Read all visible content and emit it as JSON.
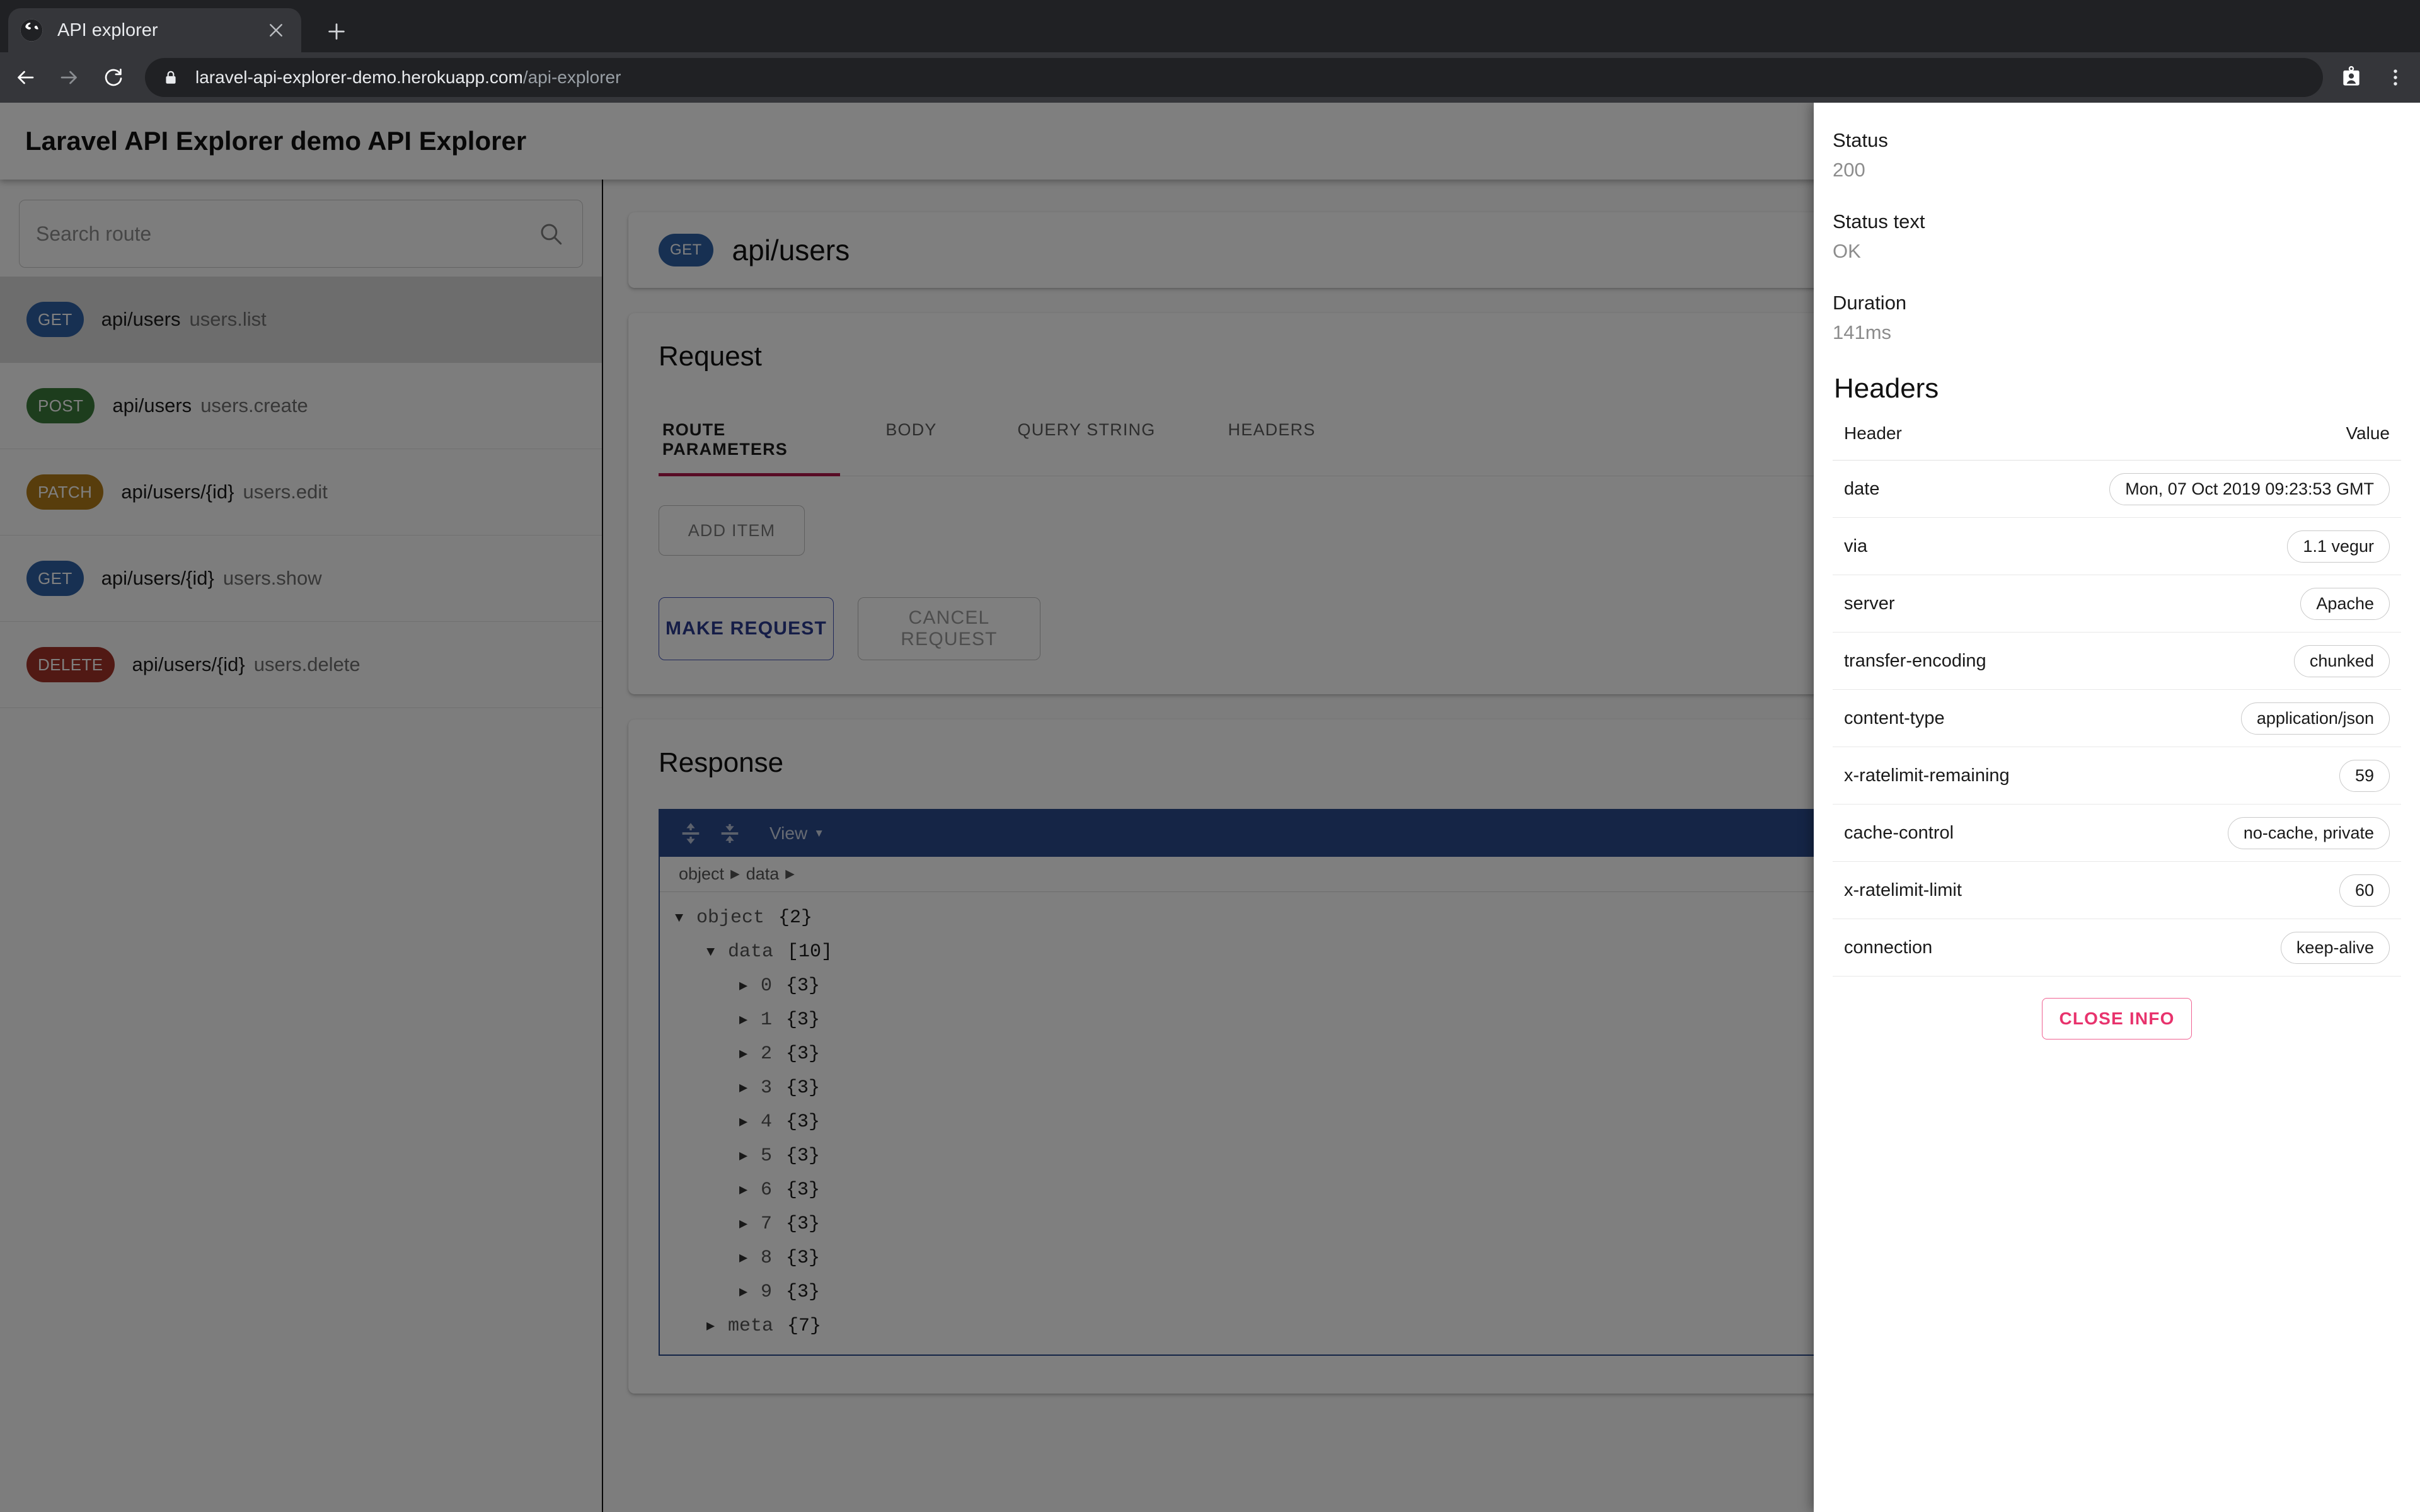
{
  "browser": {
    "tab": {
      "title": "API explorer",
      "favicon_icon": "globe-icon",
      "close_icon": "close-icon"
    },
    "new_tab_icon": "plus-icon",
    "back_icon": "arrow-left-icon",
    "forward_icon": "arrow-right-icon",
    "reload_icon": "reload-icon",
    "lock_icon": "lock-icon",
    "url_domain": "laravel-api-explorer-demo.herokuapp.com",
    "url_path": "/api-explorer",
    "profile_icon": "contact-card-icon",
    "menu_icon": "more-vertical-icon"
  },
  "appbar": {
    "title": "Laravel API Explorer demo API Explorer"
  },
  "sidebar": {
    "search": {
      "placeholder": "Search route",
      "value": "",
      "icon": "search-icon"
    },
    "routes": [
      {
        "method": "GET",
        "uri": "api/users",
        "name": "users.list",
        "color": "#2f61a5",
        "selected": true
      },
      {
        "method": "POST",
        "uri": "api/users",
        "name": "users.create",
        "color": "#3a7a3a",
        "selected": false
      },
      {
        "method": "PATCH",
        "uri": "api/users/{id}",
        "name": "users.edit",
        "color": "#b07a18",
        "selected": false
      },
      {
        "method": "GET",
        "uri": "api/users/{id}",
        "name": "users.show",
        "color": "#2f61a5",
        "selected": false
      },
      {
        "method": "DELETE",
        "uri": "api/users/{id}",
        "name": "users.delete",
        "color": "#a33228",
        "selected": false
      }
    ]
  },
  "main": {
    "route_header": {
      "method": "GET",
      "uri": "api/users",
      "color": "#2f61a5"
    },
    "request": {
      "title": "Request",
      "tabs": [
        {
          "label": "ROUTE PARAMETERS",
          "active": true
        },
        {
          "label": "BODY",
          "active": false
        },
        {
          "label": "QUERY STRING",
          "active": false
        },
        {
          "label": "HEADERS",
          "active": false
        }
      ],
      "add_item_label": "ADD ITEM",
      "make_request_label": "MAKE REQUEST",
      "cancel_request_label": "CANCEL REQUEST"
    },
    "response": {
      "title": "Response",
      "viewer": {
        "expand_all_icon": "expand-all-icon",
        "collapse_all_icon": "collapse-all-icon",
        "view_menu_label": "View",
        "view_menu_caret_icon": "caret-down-icon",
        "breadcrumb": [
          "object",
          "data"
        ],
        "accent_color": "#2b4b8c",
        "tree": [
          {
            "depth": 0,
            "twisty": "▼",
            "key": "object",
            "count": "{2}"
          },
          {
            "depth": 1,
            "twisty": "▼",
            "key": "data",
            "count": "[10]"
          },
          {
            "depth": 2,
            "twisty": "▶",
            "key": "0",
            "count": "{3}"
          },
          {
            "depth": 2,
            "twisty": "▶",
            "key": "1",
            "count": "{3}"
          },
          {
            "depth": 2,
            "twisty": "▶",
            "key": "2",
            "count": "{3}"
          },
          {
            "depth": 2,
            "twisty": "▶",
            "key": "3",
            "count": "{3}"
          },
          {
            "depth": 2,
            "twisty": "▶",
            "key": "4",
            "count": "{3}"
          },
          {
            "depth": 2,
            "twisty": "▶",
            "key": "5",
            "count": "{3}"
          },
          {
            "depth": 2,
            "twisty": "▶",
            "key": "6",
            "count": "{3}"
          },
          {
            "depth": 2,
            "twisty": "▶",
            "key": "7",
            "count": "{3}"
          },
          {
            "depth": 2,
            "twisty": "▶",
            "key": "8",
            "count": "{3}"
          },
          {
            "depth": 2,
            "twisty": "▶",
            "key": "9",
            "count": "{3}"
          },
          {
            "depth": 1,
            "twisty": "▶",
            "key": "meta",
            "count": "{7}"
          }
        ]
      }
    }
  },
  "info_drawer": {
    "meta": [
      {
        "label": "Status",
        "value": "200"
      },
      {
        "label": "Status text",
        "value": "OK"
      },
      {
        "label": "Duration",
        "value": "141ms"
      }
    ],
    "headers_title": "Headers",
    "columns": {
      "name": "Header",
      "value": "Value"
    },
    "headers": [
      {
        "name": "date",
        "value": "Mon, 07 Oct 2019 09:23:53 GMT"
      },
      {
        "name": "via",
        "value": "1.1 vegur"
      },
      {
        "name": "server",
        "value": "Apache"
      },
      {
        "name": "transfer-encoding",
        "value": "chunked"
      },
      {
        "name": "content-type",
        "value": "application/json"
      },
      {
        "name": "x-ratelimit-remaining",
        "value": "59"
      },
      {
        "name": "cache-control",
        "value": "no-cache, private"
      },
      {
        "name": "x-ratelimit-limit",
        "value": "60"
      },
      {
        "name": "connection",
        "value": "keep-alive"
      }
    ],
    "close_label": "CLOSE INFO",
    "close_color": "#e8336d"
  }
}
